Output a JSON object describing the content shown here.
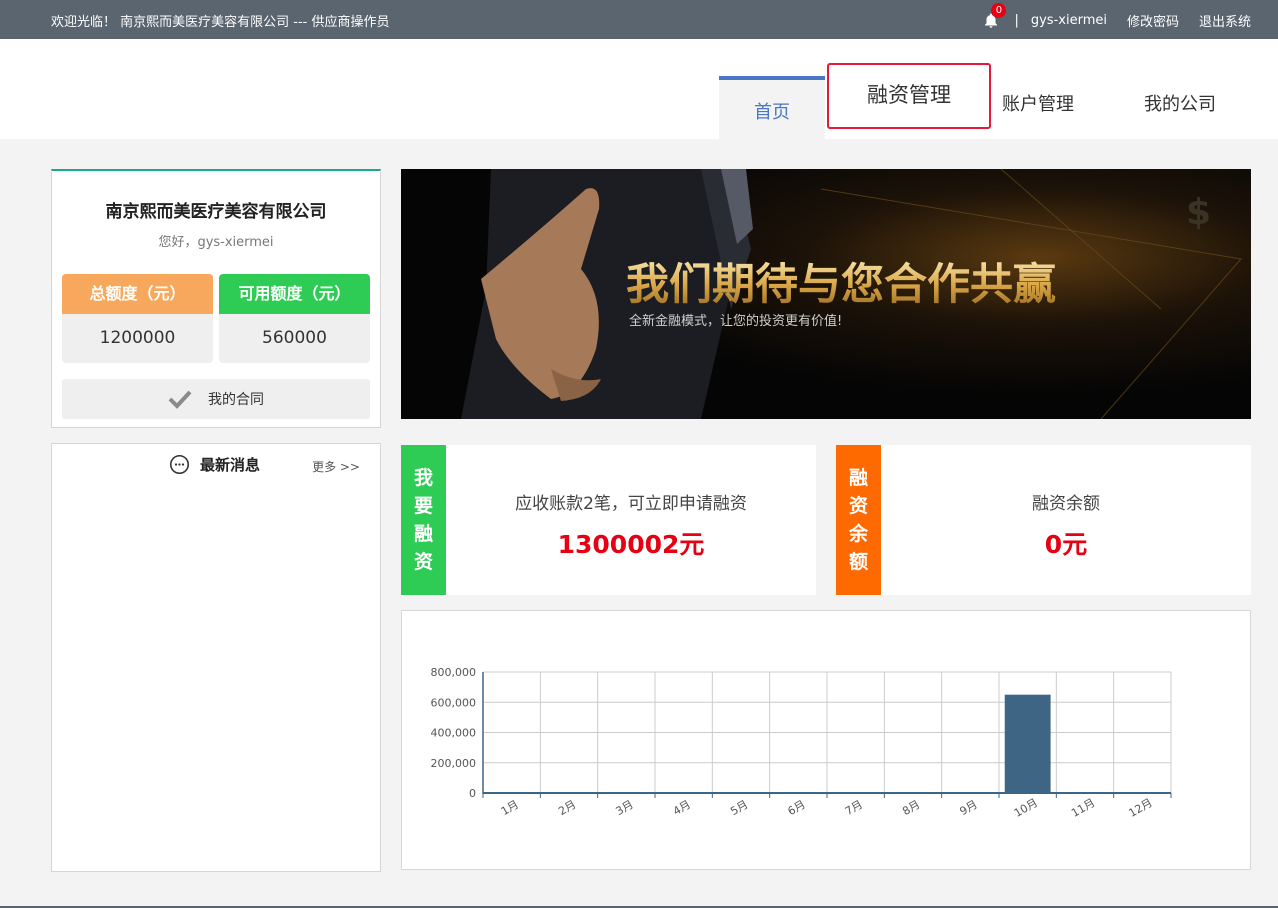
{
  "topbar": {
    "welcome": "欢迎光临！ 南京熙而美医疗美容有限公司 --- 供应商操作员",
    "notification_count": "0",
    "separator": "|",
    "username": "gys-xiermei",
    "change_password": "修改密码",
    "logout": "退出系统"
  },
  "nav": {
    "home": "首页",
    "finance": "融资管理",
    "account": "账户管理",
    "company": "我的公司"
  },
  "profile": {
    "company_name": "南京熙而美医疗美容有限公司",
    "greeting": "您好，gys-xiermei",
    "total_label": "总额度（元）",
    "total_value": "1200000",
    "available_label": "可用额度（元）",
    "available_value": "560000",
    "contract": "我的合同"
  },
  "banner": {
    "headline": "我们期待与您合作共赢",
    "subline": "全新金融模式，让您的投资更有价值!"
  },
  "news": {
    "title": "最新消息",
    "more": "更多 >>"
  },
  "apply_card": {
    "side": [
      "我",
      "要",
      "融",
      "资"
    ],
    "text": "应收账款2笔，可立即申请融资",
    "amount": "1300002元"
  },
  "balance_card": {
    "side": [
      "融",
      "资",
      "余",
      "额"
    ],
    "text": "融资余额",
    "amount": "0元"
  },
  "colors": {
    "topbar": "#5a6570",
    "accent_blue": "#4a76c4",
    "highlight_red": "#e6183b",
    "green": "#2ecc55",
    "orange": "#ff6a00",
    "amount_red": "#e60012",
    "bar": "#3f6585"
  },
  "chart_data": {
    "type": "bar",
    "categories": [
      "1月",
      "2月",
      "3月",
      "4月",
      "5月",
      "6月",
      "7月",
      "8月",
      "9月",
      "10月",
      "11月",
      "12月"
    ],
    "values": [
      0,
      0,
      0,
      0,
      0,
      0,
      0,
      0,
      0,
      650000,
      0,
      0
    ],
    "ylim": [
      0,
      800000
    ],
    "yticks": [
      0,
      200000,
      400000,
      600000,
      800000
    ],
    "ytick_labels": [
      "0",
      "200,000",
      "400,000",
      "600,000",
      "800,000"
    ],
    "grid": true,
    "title": "",
    "xlabel": "",
    "ylabel": ""
  }
}
